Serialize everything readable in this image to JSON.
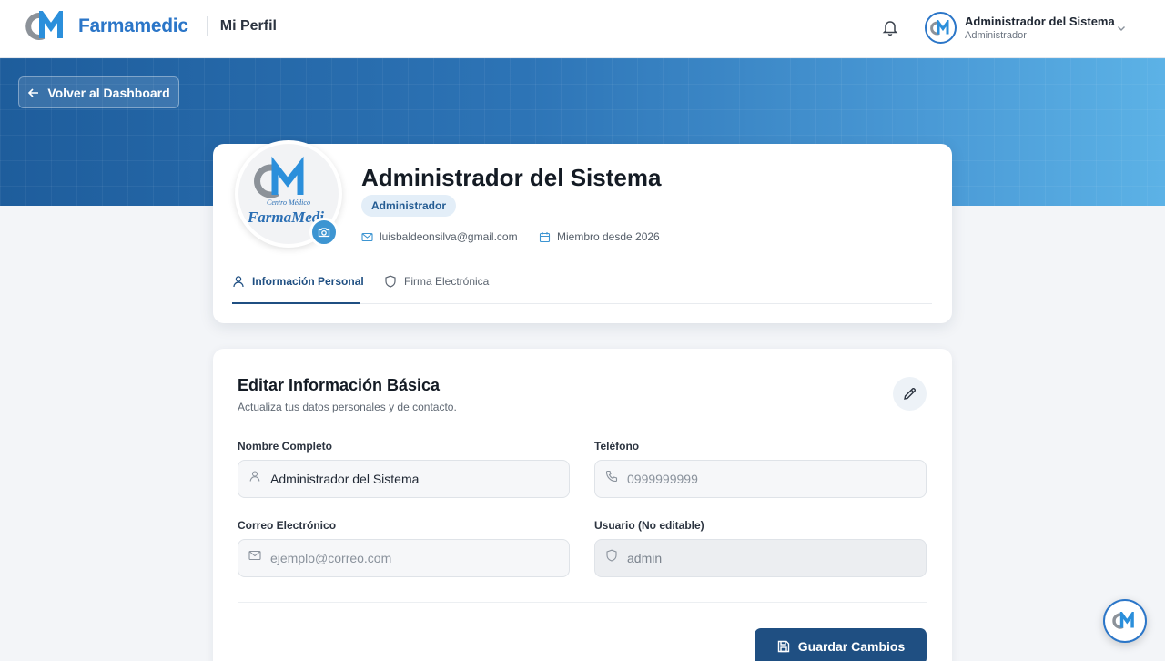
{
  "brand": {
    "name": "Farmamedic",
    "section": "Mi Perfil"
  },
  "header": {
    "user_name": "Administrador del Sistema",
    "user_role": "Administrador"
  },
  "hero": {
    "back_label": "Volver al Dashboard"
  },
  "profile": {
    "name": "Administrador del Sistema",
    "role": "Administrador",
    "email": "luisbaldeonsilva@gmail.com",
    "member_since": "Miembro desde 2026",
    "photo_text": {
      "top": "Centro Médico",
      "bottom": "FarmaMedi"
    }
  },
  "tabs": [
    {
      "label": "Información Personal",
      "icon": "user-icon",
      "active": true
    },
    {
      "label": "Firma Electrónica",
      "icon": "shield-icon",
      "active": false
    }
  ],
  "form": {
    "title": "Editar Información Básica",
    "subtitle": "Actualiza tus datos personales y de contacto.",
    "fields": {
      "full_name": {
        "label": "Nombre Completo",
        "value": "Administrador del Sistema",
        "placeholder": ""
      },
      "phone": {
        "label": "Teléfono",
        "value": "",
        "placeholder": "0999999999"
      },
      "email": {
        "label": "Correo Electrónico",
        "value": "",
        "placeholder": "ejemplo@correo.com"
      },
      "username": {
        "label": "Usuario (No editable)",
        "value": "admin",
        "placeholder": ""
      }
    },
    "save_label": "Guardar Cambios"
  },
  "colors": {
    "primary": "#1f4f82",
    "accent": "#2b76c8",
    "hero_start": "#1e5d9c",
    "hero_end": "#5cb2e6"
  }
}
